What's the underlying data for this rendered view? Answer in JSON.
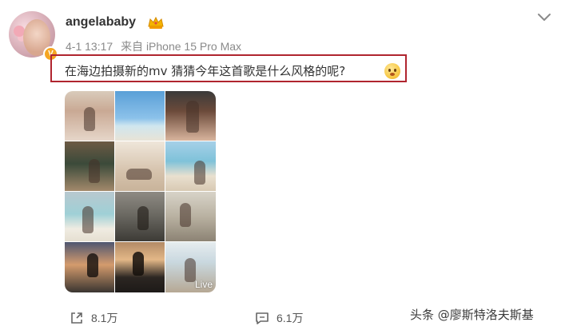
{
  "post": {
    "username": "angelababy",
    "date": "4-1 13:17",
    "source": "来自 iPhone 15 Pro Max",
    "caption": "在海边拍摄新的mv 猜猜今年这首歌是什么风格的呢?",
    "verified_badge": "V",
    "photos": [
      {
        "name": "photo-1"
      },
      {
        "name": "photo-2"
      },
      {
        "name": "photo-3"
      },
      {
        "name": "photo-4"
      },
      {
        "name": "photo-5"
      },
      {
        "name": "photo-6"
      },
      {
        "name": "photo-7"
      },
      {
        "name": "photo-8"
      },
      {
        "name": "photo-9"
      },
      {
        "name": "photo-10"
      },
      {
        "name": "photo-11"
      },
      {
        "name": "photo-12"
      }
    ],
    "live_label": "Live"
  },
  "actions": {
    "share_count": "8.1万",
    "comment_count": "6.1万"
  },
  "watermark": "头条 @廖斯特洛夫斯基",
  "icons": {
    "crown": "crown-icon",
    "verified": "verified-badge-icon",
    "chevron": "chevron-down-icon",
    "emoji": "thinking-face-icon",
    "share": "share-icon",
    "comment": "comment-icon"
  },
  "colors": {
    "caption_highlight": "#b0252f",
    "verified": "#f5a623",
    "meta_text": "#8a8a8a"
  }
}
